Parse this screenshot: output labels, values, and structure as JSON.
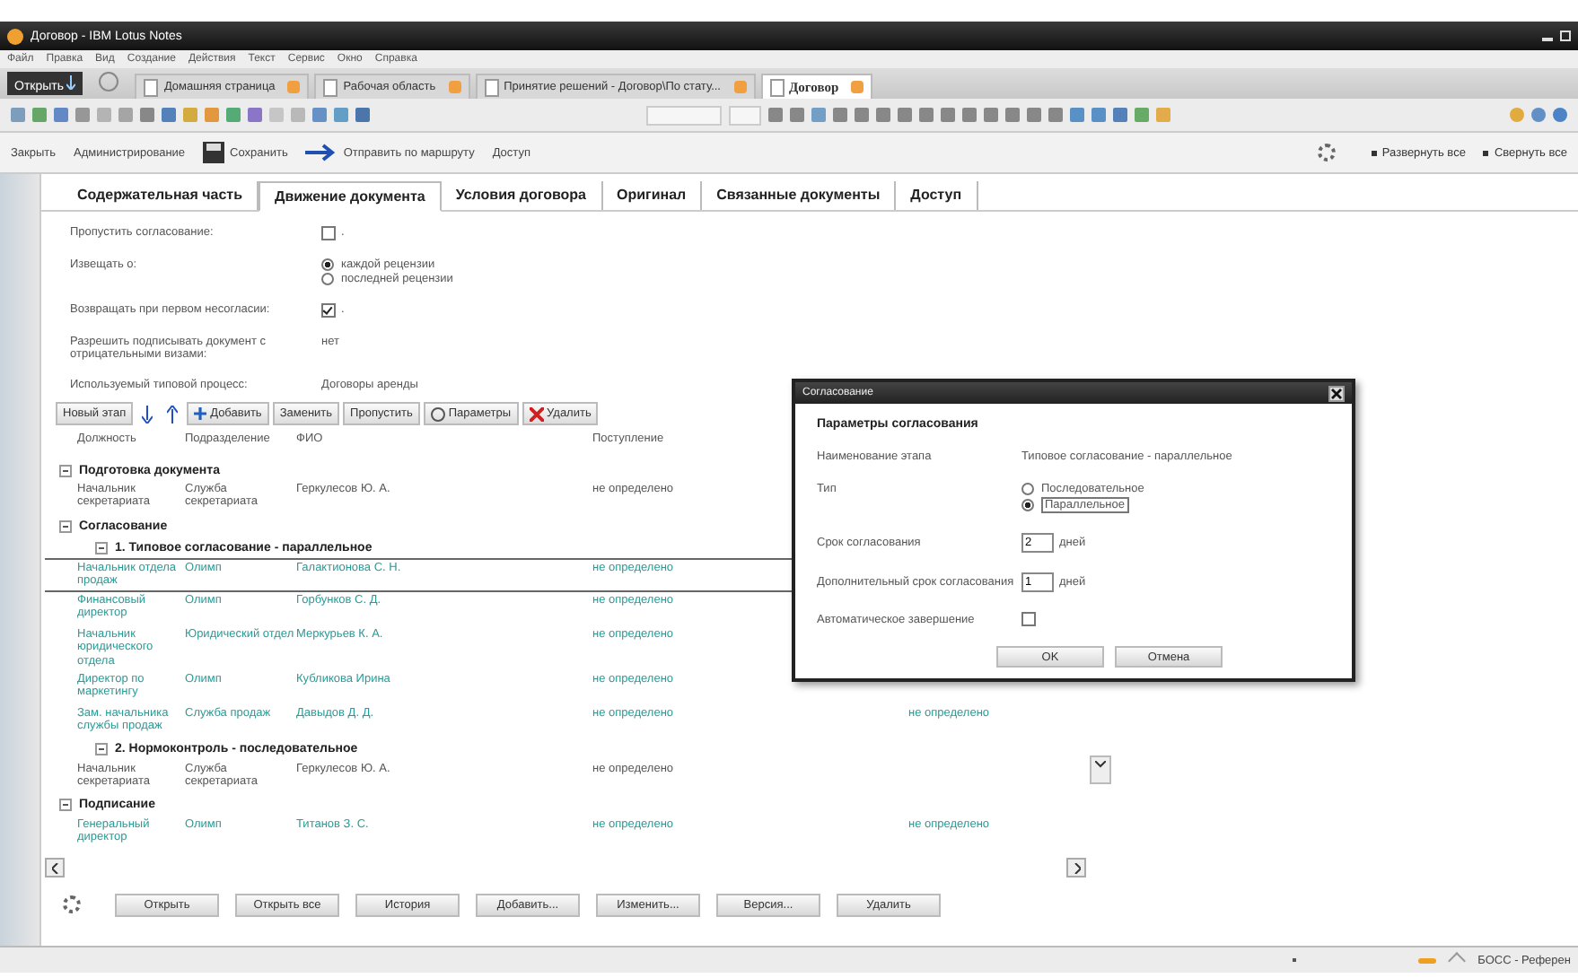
{
  "window": {
    "title": "Договор - IBM Lotus Notes"
  },
  "menu": [
    "Файл",
    "Правка",
    "Вид",
    "Создание",
    "Действия",
    "Текст",
    "Сервис",
    "Окно",
    "Справка"
  ],
  "open_button": "Открыть",
  "tabs": [
    {
      "label": "Домашняя страница",
      "selected": false
    },
    {
      "label": "Рабочая область",
      "selected": false
    },
    {
      "label": "Принятие решений - Договор\\По стату...",
      "selected": false
    },
    {
      "label": "Договор",
      "selected": true
    }
  ],
  "actions": [
    {
      "label": "Закрыть",
      "kind": "text"
    },
    {
      "label": "Администрирование",
      "kind": "text"
    },
    {
      "label": "Сохранить",
      "kind": "save"
    },
    {
      "label": "Отправить по маршруту",
      "kind": "send"
    },
    {
      "label": "Доступ",
      "kind": "text"
    }
  ],
  "expand_links": [
    "Развернуть все",
    "Свернуть все"
  ],
  "doc_tabs": [
    {
      "label": "Содержательная часть",
      "selected": false
    },
    {
      "label": "Движение документа",
      "selected": true
    },
    {
      "label": "Условия договора",
      "selected": false
    },
    {
      "label": "Оригинал",
      "selected": false
    },
    {
      "label": "Связанные документы",
      "selected": false
    },
    {
      "label": "Доступ",
      "selected": false
    }
  ],
  "fields": [
    {
      "label": "Пропустить согласование:",
      "kind": "checkbox",
      "checked": false,
      "suffix": "."
    },
    {
      "label": "Извещать о:",
      "kind": "radio",
      "options": [
        {
          "label": "каждой рецензии",
          "selected": true
        },
        {
          "label": "последней рецензии",
          "selected": false
        }
      ]
    },
    {
      "label": "Возвращать при первом несогласии:",
      "kind": "checkbox",
      "checked": true,
      "suffix": "."
    },
    {
      "label": "Разрешить подписывать документ с отрицательными визами:",
      "kind": "text",
      "value": "нет"
    },
    {
      "label": "Используемый типовой процесс:",
      "kind": "text",
      "value": "Договоры аренды"
    }
  ],
  "stage_toolbar": [
    {
      "label": "Новый этап",
      "kind": "text"
    },
    {
      "kind": "down"
    },
    {
      "kind": "up"
    },
    {
      "label": "Добавить",
      "kind": "add"
    },
    {
      "label": "Заменить",
      "kind": "text"
    },
    {
      "label": "Пропустить",
      "kind": "text"
    },
    {
      "label": "Параметры",
      "kind": "params"
    },
    {
      "label": "Удалить",
      "kind": "delete"
    }
  ],
  "table": {
    "columns": [
      "Должность",
      "Подразделение",
      "ФИО",
      "Поступление"
    ],
    "groups": [
      {
        "title": "Подготовка документа",
        "expanded": true,
        "children": [
          {
            "kind": "row",
            "selected": false,
            "color": "#555555",
            "cells": [
              "Начальник секретариата",
              "Служба секретариата",
              "Геркулесов Ю. А.",
              "не определено"
            ]
          }
        ]
      },
      {
        "title": "Согласование",
        "expanded": true,
        "children": [
          {
            "kind": "group",
            "title": "1. Типовое согласование - параллельное",
            "expanded": true,
            "children": [
              {
                "kind": "row",
                "selected": true,
                "color": "#2a9a96",
                "cells": [
                  "Начальник отдела продаж",
                  "Олимп",
                  "Галактионова С. Н.",
                  "не определено"
                ]
              },
              {
                "kind": "row",
                "selected": false,
                "color": "#2a9a96",
                "cells": [
                  "Финансовый директор",
                  "Олимп",
                  "Горбунков С. Д.",
                  "не определено"
                ]
              },
              {
                "kind": "row",
                "selected": false,
                "color": "#2a9a96",
                "cells": [
                  "Начальник юридического отдела",
                  "Юридический отдел",
                  "Меркурьев К. А.",
                  "не определено"
                ]
              },
              {
                "kind": "row",
                "selected": false,
                "color": "#2a9a96",
                "cells": [
                  "Директор по маркетингу",
                  "Олимп",
                  "Кубликова Ирина",
                  "не определено"
                ]
              },
              {
                "kind": "row",
                "selected": false,
                "color": "#2a9a96",
                "cells": [
                  "Зам. начальника службы продаж",
                  "Служба продаж",
                  "Давыдов Д. Д.",
                  "не определено"
                ],
                "column_5": "не определено"
              }
            ]
          },
          {
            "kind": "group",
            "title": "2. Нормоконтроль - последовательное",
            "expanded": true,
            "children": [
              {
                "kind": "row",
                "selected": false,
                "color": "#555555",
                "cells": [
                  "Начальник секретариата",
                  "Служба секретариата",
                  "Геркулесов Ю. А.",
                  "не определено"
                ]
              }
            ]
          }
        ]
      },
      {
        "title": "Подписание",
        "expanded": true,
        "children": [
          {
            "kind": "row",
            "selected": false,
            "color": "#2a9a96",
            "cells": [
              "Генеральный директор",
              "Олимп",
              "Титанов З. С.",
              "не определено"
            ],
            "column_5": "не определено"
          }
        ]
      }
    ]
  },
  "bottom_buttons": [
    "Открыть",
    "Открыть все",
    "История",
    "Добавить...",
    "Изменить...",
    "Версия...",
    "Удалить"
  ],
  "status_bar": {
    "text": "БОСС - Референ"
  },
  "dialog": {
    "title": "Согласование",
    "heading": "Параметры согласования",
    "stage_label": "Наименование этапа",
    "stage_value": "Типовое согласование - параллельное",
    "type_label": "Тип",
    "type_options": [
      {
        "label": "Последовательное",
        "selected": false
      },
      {
        "label": "Параллельное",
        "selected": true
      }
    ],
    "term_label": "Срок согласования",
    "term_value": "2",
    "term_unit": "дней",
    "extra_label": "Дополнительный срок согласования",
    "extra_value": "1",
    "extra_unit": "дней",
    "auto_label": "Автоматическое завершение",
    "auto_checked": false,
    "buttons": [
      "OK",
      "Отмена"
    ]
  }
}
